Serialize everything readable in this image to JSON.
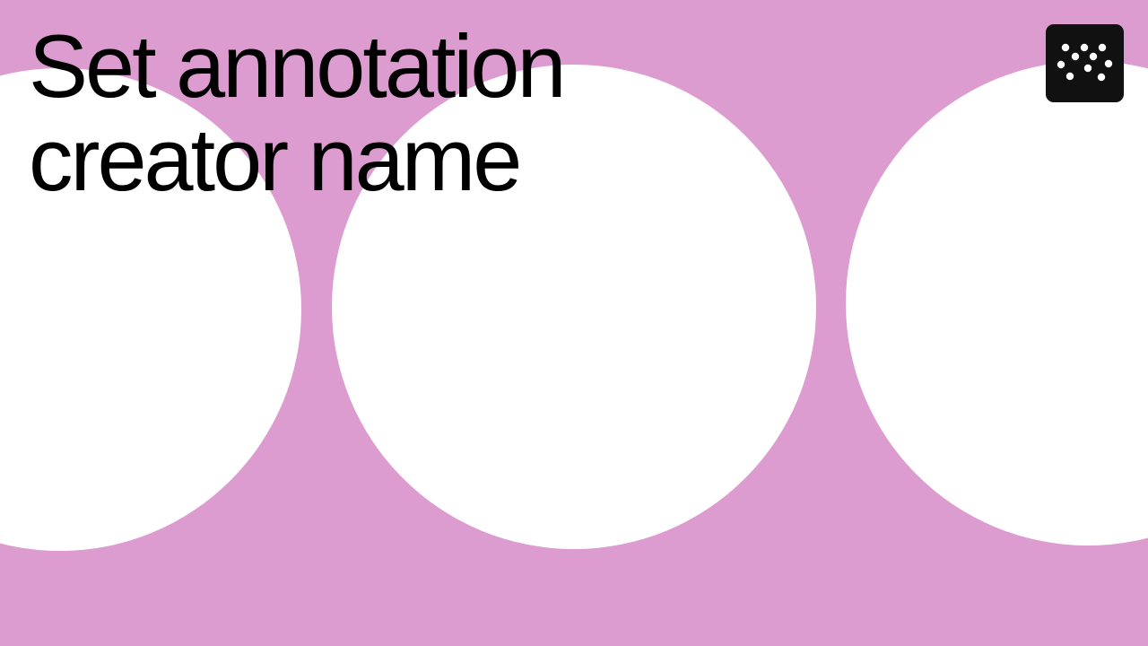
{
  "slide": {
    "title_line_1": "Set annotation",
    "title_line_2": "creator name"
  },
  "colors": {
    "background": "#dd9ccf",
    "circle": "#ffffff",
    "logo_background": "#111111",
    "logo_dots": "#ffffff",
    "text": "#000000"
  },
  "icons": {
    "logo": "dotted-pattern-logo-icon"
  }
}
